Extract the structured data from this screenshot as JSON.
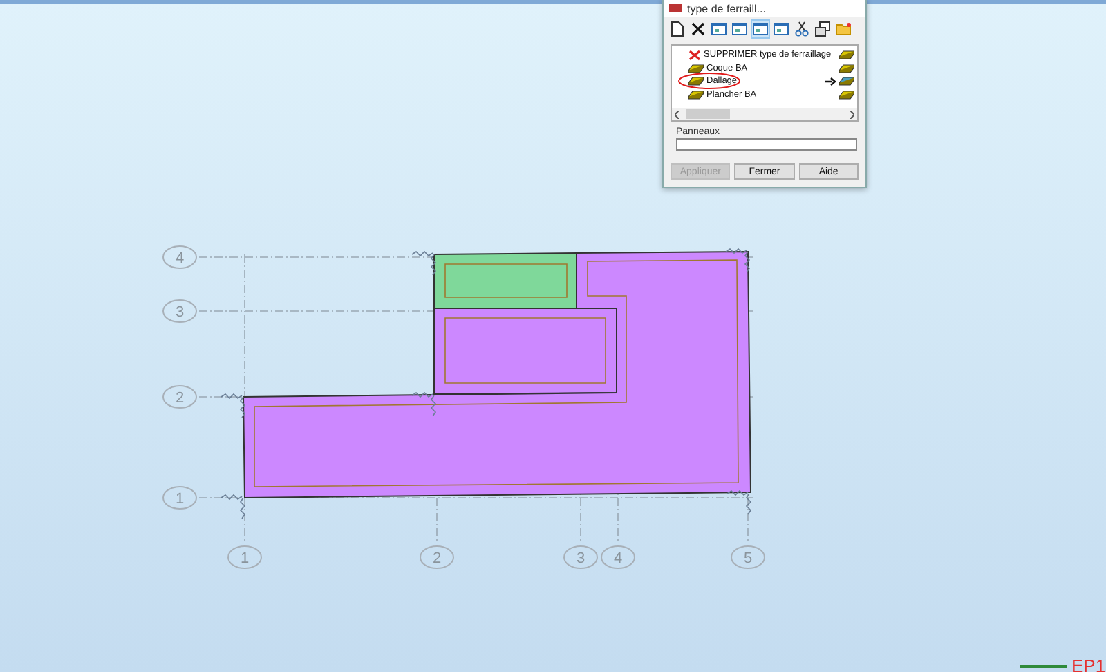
{
  "dialog": {
    "title": "type de ferraill...",
    "toolbar": [
      {
        "kind": "new"
      },
      {
        "kind": "delete"
      },
      {
        "kind": "panel",
        "selected": false
      },
      {
        "kind": "panel",
        "selected": false
      },
      {
        "kind": "panel",
        "selected": true
      },
      {
        "kind": "panel",
        "selected": false
      },
      {
        "kind": "cut"
      },
      {
        "kind": "props"
      },
      {
        "kind": "folder"
      }
    ],
    "list": [
      {
        "kind": "delete",
        "label": "SUPPRIMER type de ferraillage",
        "current": false,
        "circled": false
      },
      {
        "kind": "type",
        "label": "Coque BA",
        "current": false,
        "circled": false
      },
      {
        "kind": "type",
        "label": "Dallage",
        "current": true,
        "circled": true
      },
      {
        "kind": "type",
        "label": "Plancher BA",
        "current": false,
        "circled": false
      }
    ],
    "panels_label": "Panneaux",
    "buttons": [
      {
        "label": "Appliquer",
        "disabled": true
      },
      {
        "label": "Fermer",
        "disabled": false
      },
      {
        "label": "Aide",
        "disabled": false
      }
    ]
  },
  "plan": {
    "row_axes": [
      "4",
      "3",
      "2",
      "1"
    ],
    "column_axes": [
      "1",
      "2",
      "3",
      "4",
      "5"
    ],
    "slabs": [
      {
        "color": "#7fd89a"
      },
      {
        "color": "#cc88ff"
      },
      {
        "color": "#cc88ff"
      }
    ],
    "legend": "EP1"
  }
}
